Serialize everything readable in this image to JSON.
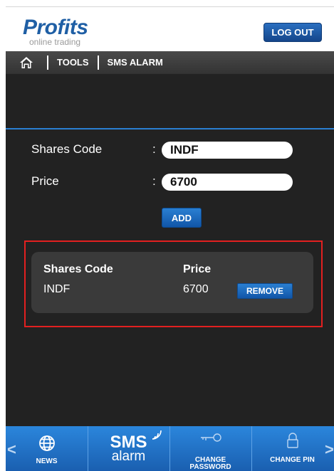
{
  "header": {
    "logo_main": "Profits",
    "logo_sub": "online trading",
    "logout_label": "LOG OUT"
  },
  "breadcrumb": {
    "home_icon": "home-icon",
    "items": [
      "TOOLS",
      "SMS ALARM"
    ]
  },
  "form": {
    "code_label": "Shares Code",
    "code_value": "INDF",
    "price_label": "Price",
    "price_value": "6700",
    "colon": ":",
    "add_label": "ADD"
  },
  "alarm_list": {
    "headers": {
      "code": "Shares Code",
      "price": "Price"
    },
    "rows": [
      {
        "code": "INDF",
        "price": "6700",
        "action": "REMOVE"
      }
    ]
  },
  "bottom_nav": {
    "left_arrow": "<",
    "right_arrow": ">",
    "items": [
      {
        "label": "NEWS",
        "icon": "globe-icon"
      },
      {
        "logo_top": "SMS",
        "logo_bottom": "alarm",
        "icon": "sms-alarm-icon"
      },
      {
        "label": "CHANGE PASSWORD",
        "icon": "key-icon"
      },
      {
        "label": "CHANGE PIN",
        "icon": "lock-icon"
      }
    ]
  },
  "colors": {
    "brand_blue": "#1f5fa5",
    "accent_blue": "#2a7fd2",
    "highlight_red": "#e32020",
    "panel_dark": "#222222"
  }
}
